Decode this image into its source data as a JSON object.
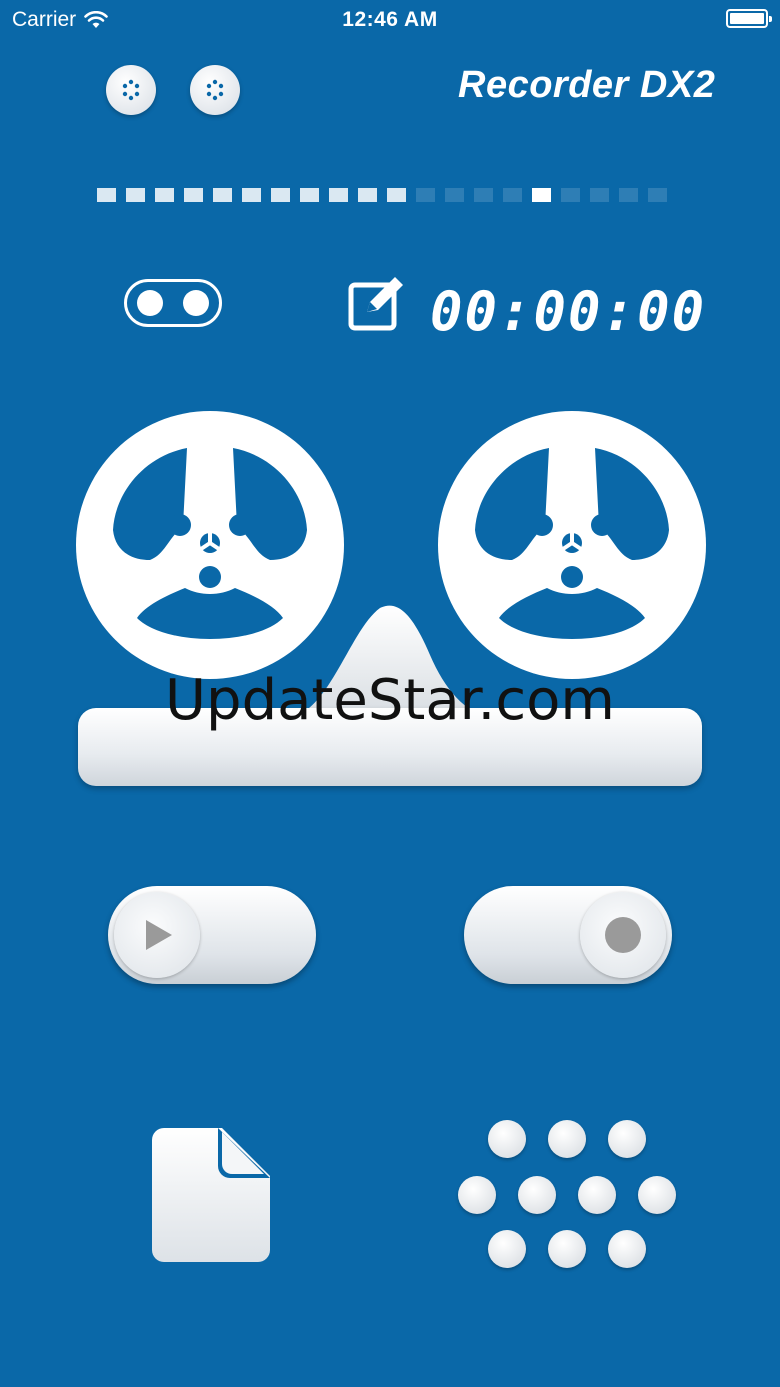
{
  "status_bar": {
    "carrier": "Carrier",
    "time": "12:46 AM"
  },
  "header": {
    "logo_text": "Recorder DX2"
  },
  "level_meter": {
    "segments": 20,
    "active": 11,
    "peak_index": 15
  },
  "timer": {
    "value": "00:00:00"
  },
  "watermark": {
    "text": "UpdateStar.com"
  },
  "icons": {
    "wifi": "wifi-icon",
    "battery": "battery-icon",
    "menu_left": "dots-icon",
    "menu_right": "dots-icon",
    "toggle": "toggle-icon",
    "edit": "edit-icon",
    "play": "play-icon",
    "record": "record-icon",
    "file": "file-icon",
    "keypad": "keypad-icon"
  },
  "colors": {
    "background": "#0a68a8",
    "foreground": "#ffffff",
    "knob_gray": "#9a9a9a"
  }
}
